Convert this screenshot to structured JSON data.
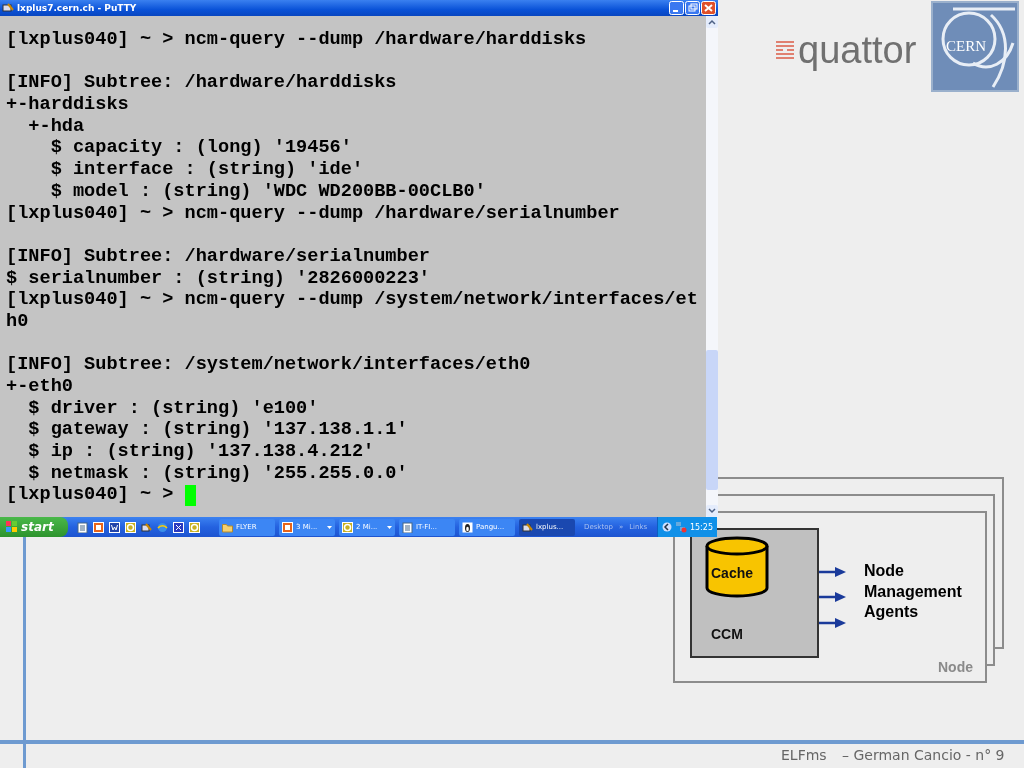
{
  "window": {
    "title": "lxplus7.cern.ch - PuTTY"
  },
  "terminal": {
    "cursor": true,
    "blocks": [
      {
        "lines": [
          "[lxplus040] ~ > ncm-query --dump /hardware/harddisks"
        ]
      },
      {
        "lines": [
          "[INFO] Subtree: /hardware/harddisks",
          "+-harddisks",
          "  +-hda",
          "    $ capacity : (long) '19456'",
          "    $ interface : (string) 'ide'",
          "    $ model : (string) 'WDC WD200BB-00CLB0'",
          "[lxplus040] ~ > ncm-query --dump /hardware/serialnumber"
        ]
      },
      {
        "lines": [
          "[INFO] Subtree: /hardware/serialnumber",
          "$ serialnumber : (string) '2826000223'",
          "[lxplus040] ~ > ncm-query --dump /system/network/interfaces/et",
          "h0"
        ]
      },
      {
        "lines": [
          "[INFO] Subtree: /system/network/interfaces/eth0",
          "+-eth0",
          "  $ driver : (string) 'e100'",
          "  $ gateway : (string) '137.138.1.1'",
          "  $ ip : (string) '137.138.4.212'",
          "  $ netmask : (string) '255.255.0.0'",
          "[lxplus040] ~ > "
        ]
      }
    ]
  },
  "taskbar": {
    "start": "start",
    "quick_launch": [
      {
        "kind": "document"
      },
      {
        "kind": "slides"
      },
      {
        "kind": "word"
      },
      {
        "kind": "circle"
      },
      {
        "kind": "terminal"
      },
      {
        "kind": "globe"
      },
      {
        "kind": "network"
      },
      {
        "kind": "circle"
      }
    ],
    "tasks": [
      {
        "label": "FLYER",
        "kind": "folder",
        "grouped": false,
        "selected": false
      },
      {
        "label": "3 Mi...",
        "kind": "slides",
        "grouped": true,
        "selected": false
      },
      {
        "label": "2 Mi...",
        "kind": "circle",
        "grouped": true,
        "selected": false
      },
      {
        "label": "IT-FI...",
        "kind": "document",
        "grouped": false,
        "selected": false
      },
      {
        "label": "Pangu...",
        "kind": "penguin",
        "grouped": false,
        "selected": false
      },
      {
        "label": "lxplus...",
        "kind": "terminal",
        "grouped": false,
        "selected": true
      }
    ],
    "toolbars": [
      "Desktop",
      "»",
      "Links"
    ],
    "clock": "15:25"
  },
  "logos": {
    "quattor": "quattor",
    "cern": "CERN"
  },
  "diagram": {
    "cache_label": "Cache",
    "box_label": "CCM",
    "agents_label": "Node Management Agents",
    "node_label": "Node"
  },
  "footer": {
    "project": "ELFms",
    "author": "– German Cancio - n° 9"
  }
}
